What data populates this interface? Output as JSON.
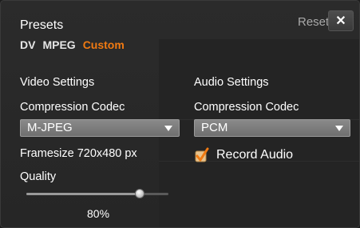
{
  "header": {
    "title": "Presets",
    "reset_label": "Reset",
    "close_label": "✕"
  },
  "presets": {
    "tabs": [
      {
        "label": "DV",
        "active": false
      },
      {
        "label": "MPEG",
        "active": false
      },
      {
        "label": "Custom",
        "active": true
      }
    ]
  },
  "video": {
    "heading": "Video Settings",
    "codec_label": "Compression Codec",
    "codec_value": "M-JPEG",
    "framesize_text": "Framesize 720x480 px",
    "quality_label": "Quality",
    "quality_value_text": "80%",
    "quality_fraction": 0.8
  },
  "audio": {
    "heading": "Audio Settings",
    "codec_label": "Compression Codec",
    "codec_value": "PCM",
    "record_audio_label": "Record Audio",
    "record_audio_checked": true
  },
  "colors": {
    "accent": "#f07a12",
    "panel_bg": "#2b2b2b",
    "select_bg": "#7d7d7d"
  }
}
